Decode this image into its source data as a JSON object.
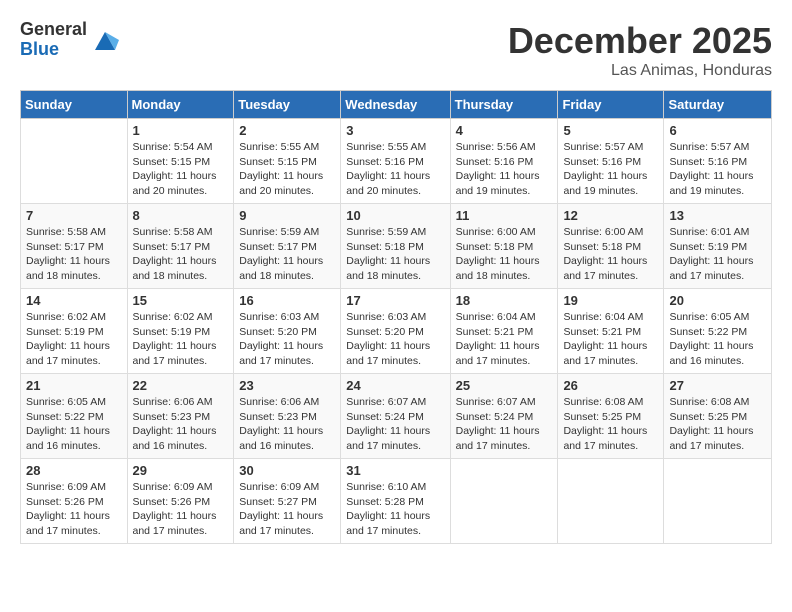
{
  "header": {
    "logo_general": "General",
    "logo_blue": "Blue",
    "month": "December 2025",
    "location": "Las Animas, Honduras"
  },
  "days_of_week": [
    "Sunday",
    "Monday",
    "Tuesday",
    "Wednesday",
    "Thursday",
    "Friday",
    "Saturday"
  ],
  "weeks": [
    [
      {
        "day": "",
        "info": ""
      },
      {
        "day": "1",
        "info": "Sunrise: 5:54 AM\nSunset: 5:15 PM\nDaylight: 11 hours\nand 20 minutes."
      },
      {
        "day": "2",
        "info": "Sunrise: 5:55 AM\nSunset: 5:15 PM\nDaylight: 11 hours\nand 20 minutes."
      },
      {
        "day": "3",
        "info": "Sunrise: 5:55 AM\nSunset: 5:16 PM\nDaylight: 11 hours\nand 20 minutes."
      },
      {
        "day": "4",
        "info": "Sunrise: 5:56 AM\nSunset: 5:16 PM\nDaylight: 11 hours\nand 19 minutes."
      },
      {
        "day": "5",
        "info": "Sunrise: 5:57 AM\nSunset: 5:16 PM\nDaylight: 11 hours\nand 19 minutes."
      },
      {
        "day": "6",
        "info": "Sunrise: 5:57 AM\nSunset: 5:16 PM\nDaylight: 11 hours\nand 19 minutes."
      }
    ],
    [
      {
        "day": "7",
        "info": "Sunrise: 5:58 AM\nSunset: 5:17 PM\nDaylight: 11 hours\nand 18 minutes."
      },
      {
        "day": "8",
        "info": "Sunrise: 5:58 AM\nSunset: 5:17 PM\nDaylight: 11 hours\nand 18 minutes."
      },
      {
        "day": "9",
        "info": "Sunrise: 5:59 AM\nSunset: 5:17 PM\nDaylight: 11 hours\nand 18 minutes."
      },
      {
        "day": "10",
        "info": "Sunrise: 5:59 AM\nSunset: 5:18 PM\nDaylight: 11 hours\nand 18 minutes."
      },
      {
        "day": "11",
        "info": "Sunrise: 6:00 AM\nSunset: 5:18 PM\nDaylight: 11 hours\nand 18 minutes."
      },
      {
        "day": "12",
        "info": "Sunrise: 6:00 AM\nSunset: 5:18 PM\nDaylight: 11 hours\nand 17 minutes."
      },
      {
        "day": "13",
        "info": "Sunrise: 6:01 AM\nSunset: 5:19 PM\nDaylight: 11 hours\nand 17 minutes."
      }
    ],
    [
      {
        "day": "14",
        "info": "Sunrise: 6:02 AM\nSunset: 5:19 PM\nDaylight: 11 hours\nand 17 minutes."
      },
      {
        "day": "15",
        "info": "Sunrise: 6:02 AM\nSunset: 5:19 PM\nDaylight: 11 hours\nand 17 minutes."
      },
      {
        "day": "16",
        "info": "Sunrise: 6:03 AM\nSunset: 5:20 PM\nDaylight: 11 hours\nand 17 minutes."
      },
      {
        "day": "17",
        "info": "Sunrise: 6:03 AM\nSunset: 5:20 PM\nDaylight: 11 hours\nand 17 minutes."
      },
      {
        "day": "18",
        "info": "Sunrise: 6:04 AM\nSunset: 5:21 PM\nDaylight: 11 hours\nand 17 minutes."
      },
      {
        "day": "19",
        "info": "Sunrise: 6:04 AM\nSunset: 5:21 PM\nDaylight: 11 hours\nand 17 minutes."
      },
      {
        "day": "20",
        "info": "Sunrise: 6:05 AM\nSunset: 5:22 PM\nDaylight: 11 hours\nand 16 minutes."
      }
    ],
    [
      {
        "day": "21",
        "info": "Sunrise: 6:05 AM\nSunset: 5:22 PM\nDaylight: 11 hours\nand 16 minutes."
      },
      {
        "day": "22",
        "info": "Sunrise: 6:06 AM\nSunset: 5:23 PM\nDaylight: 11 hours\nand 16 minutes."
      },
      {
        "day": "23",
        "info": "Sunrise: 6:06 AM\nSunset: 5:23 PM\nDaylight: 11 hours\nand 16 minutes."
      },
      {
        "day": "24",
        "info": "Sunrise: 6:07 AM\nSunset: 5:24 PM\nDaylight: 11 hours\nand 17 minutes."
      },
      {
        "day": "25",
        "info": "Sunrise: 6:07 AM\nSunset: 5:24 PM\nDaylight: 11 hours\nand 17 minutes."
      },
      {
        "day": "26",
        "info": "Sunrise: 6:08 AM\nSunset: 5:25 PM\nDaylight: 11 hours\nand 17 minutes."
      },
      {
        "day": "27",
        "info": "Sunrise: 6:08 AM\nSunset: 5:25 PM\nDaylight: 11 hours\nand 17 minutes."
      }
    ],
    [
      {
        "day": "28",
        "info": "Sunrise: 6:09 AM\nSunset: 5:26 PM\nDaylight: 11 hours\nand 17 minutes."
      },
      {
        "day": "29",
        "info": "Sunrise: 6:09 AM\nSunset: 5:26 PM\nDaylight: 11 hours\nand 17 minutes."
      },
      {
        "day": "30",
        "info": "Sunrise: 6:09 AM\nSunset: 5:27 PM\nDaylight: 11 hours\nand 17 minutes."
      },
      {
        "day": "31",
        "info": "Sunrise: 6:10 AM\nSunset: 5:28 PM\nDaylight: 11 hours\nand 17 minutes."
      },
      {
        "day": "",
        "info": ""
      },
      {
        "day": "",
        "info": ""
      },
      {
        "day": "",
        "info": ""
      }
    ]
  ]
}
